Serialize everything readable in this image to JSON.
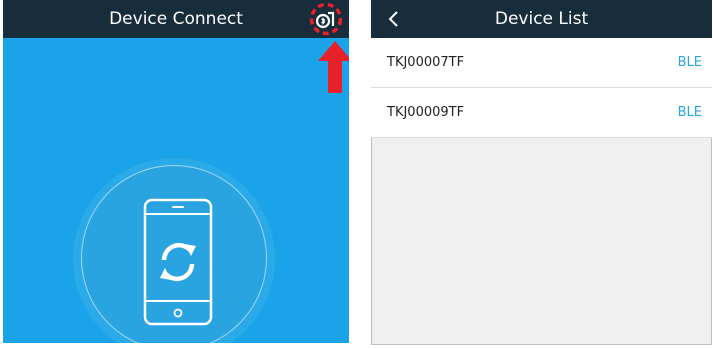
{
  "left_screen": {
    "title": "Device Connect",
    "scan_button_icon": "ble-scan-icon",
    "highlight_color": "#e8202a",
    "background_color": "#1aa3e8",
    "center_icon": "phone-sync-icon"
  },
  "right_screen": {
    "title": "Device List",
    "back_icon": "chevron-left-icon",
    "devices": [
      {
        "name": "TKJ00007TF",
        "type": "BLE"
      },
      {
        "name": "TKJ00009TF",
        "type": "BLE"
      }
    ]
  },
  "colors": {
    "header": "#172d3b",
    "accent": "#2aa3e0"
  }
}
